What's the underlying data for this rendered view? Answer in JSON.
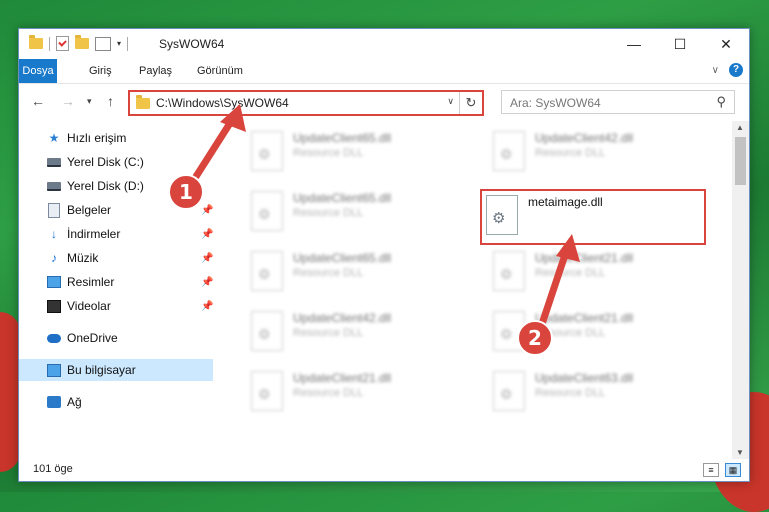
{
  "window": {
    "title": "SysWOW64",
    "controls": {
      "minimize": "—",
      "maximize": "☐",
      "close": "✕"
    }
  },
  "ribbon": {
    "tabs": [
      "Dosya",
      "Giriş",
      "Paylaş",
      "Görünüm"
    ],
    "help_icon": "?",
    "collapse_icon": "chevron-up-icon"
  },
  "navigation": {
    "back": "←",
    "forward": "→",
    "recent": "▾",
    "up": "↑",
    "address": "C:\\Windows\\SysWOW64",
    "refresh": "↻",
    "dropdown": "∨",
    "search_placeholder": "Ara: SysWOW64",
    "search_icon": "⚲"
  },
  "sidebar": {
    "items": [
      {
        "label": "Hızlı erişim",
        "icon": "star-icon",
        "pinned": false
      },
      {
        "label": "Yerel Disk (C:)",
        "icon": "drive-icon",
        "pinned": false
      },
      {
        "label": "Yerel Disk (D:)",
        "icon": "drive-icon",
        "pinned": false
      },
      {
        "label": "Belgeler",
        "icon": "documents-icon",
        "pinned": true
      },
      {
        "label": "İndirmeler",
        "icon": "download-icon",
        "pinned": true
      },
      {
        "label": "Müzik",
        "icon": "music-icon",
        "pinned": true
      },
      {
        "label": "Resimler",
        "icon": "pictures-icon",
        "pinned": true
      },
      {
        "label": "Videolar",
        "icon": "videos-icon",
        "pinned": true
      },
      {
        "label": "OneDrive",
        "icon": "cloud-icon",
        "pinned": false
      },
      {
        "label": "Bu bilgisayar",
        "icon": "computer-icon",
        "pinned": false
      },
      {
        "label": "Ağ",
        "icon": "network-icon",
        "pinned": false
      }
    ]
  },
  "files": {
    "left_column": [
      {
        "name": "UpdateClient65.dll",
        "type": "Resource DLL"
      },
      {
        "name": "UpdateClient65.dll",
        "type": "Resource DLL"
      },
      {
        "name": "UpdateClient65.dll",
        "type": "Resource DLL"
      },
      {
        "name": "UpdateClient42.dll",
        "type": "Resource DLL"
      },
      {
        "name": "UpdateClient21.dll",
        "type": "Resource DLL"
      }
    ],
    "right_column": [
      {
        "name": "UpdateClient42.dll",
        "type": "Resource DLL"
      },
      {
        "name": "UpdateClient21.dll",
        "type": "Resource DLL"
      },
      {
        "name": "UpdateClient21.dll",
        "type": "Resource DLL"
      },
      {
        "name": "UpdateClient63.dll",
        "type": "Resource DLL"
      }
    ],
    "highlighted": {
      "name": "metaimage.dll",
      "icon": "dll-file-icon"
    }
  },
  "status": {
    "item_count": "101 öge"
  },
  "annotations": {
    "step1": "1",
    "step2": "2",
    "accent_color": "#d9443c"
  }
}
